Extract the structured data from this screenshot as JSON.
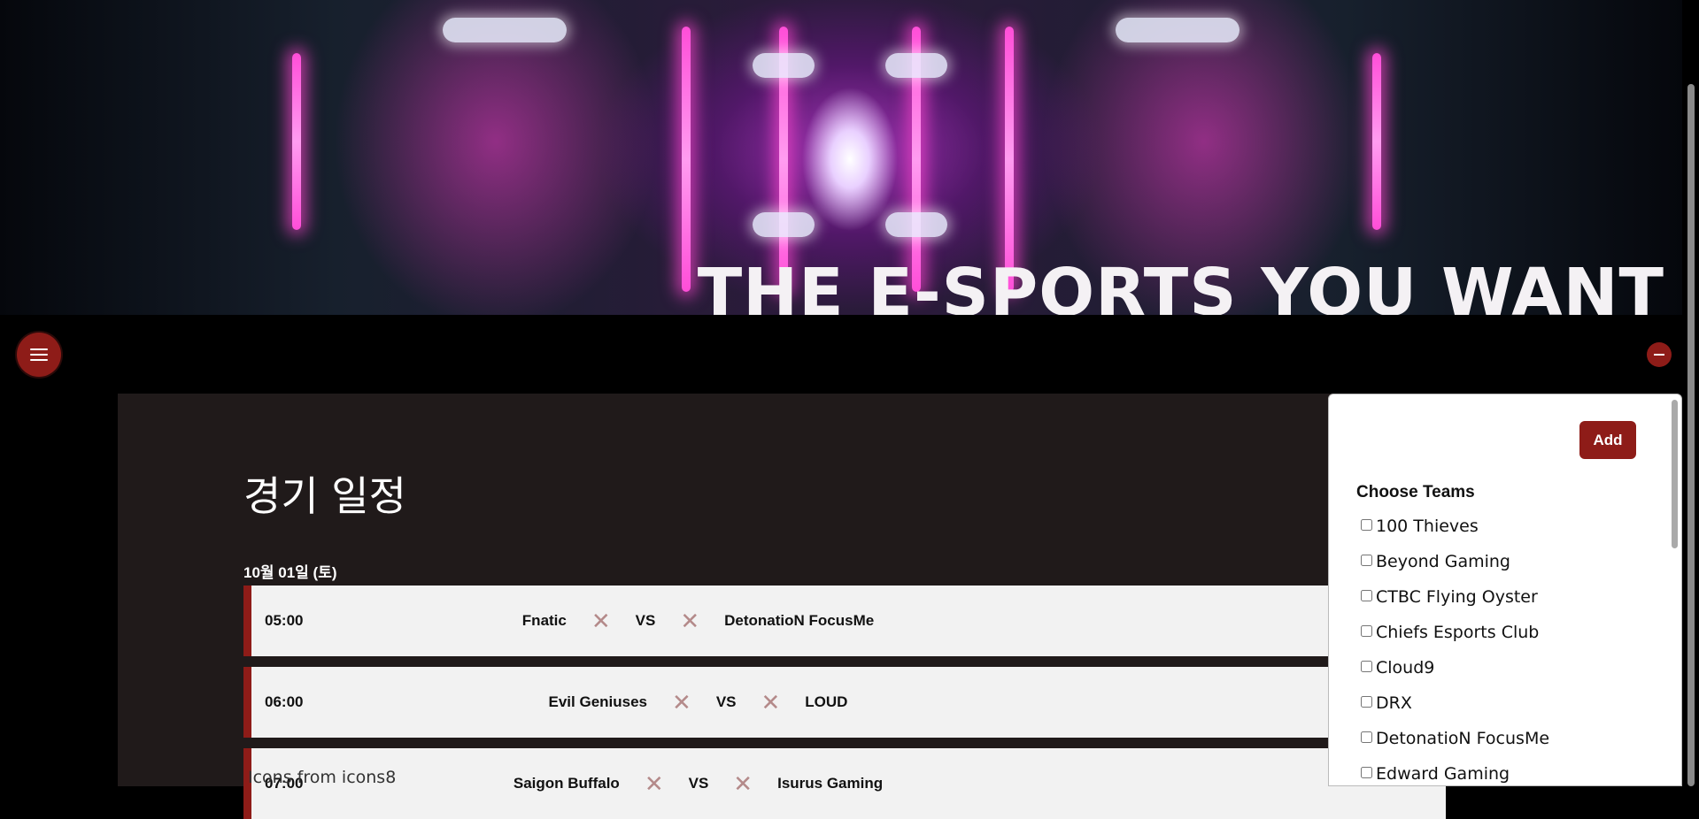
{
  "banner": {
    "title": "THE E-SPORTS YOU WANT"
  },
  "page": {
    "title": "경기 일정",
    "date": "10월 01일 (토)"
  },
  "matches": [
    {
      "time": "05:00",
      "home": "Fnatic",
      "vs": "VS",
      "away": "DetonatioN FocusMe"
    },
    {
      "time": "06:00",
      "home": "Evil Geniuses",
      "vs": "VS",
      "away": "LOUD"
    },
    {
      "time": "07:00",
      "home": "Saigon Buffalo",
      "vs": "VS",
      "away": "Isurus Gaming"
    }
  ],
  "footer": {
    "credit": "Icons from icons8"
  },
  "panel": {
    "add_label": "Add",
    "choose_label": "Choose Teams",
    "teams": [
      "100 Thieves",
      "Beyond Gaming",
      "CTBC Flying Oyster",
      "Chiefs Esports Club",
      "Cloud9",
      "DRX",
      "DetonatioN FocusMe",
      "Edward Gaming"
    ]
  },
  "icons": {
    "menu": "hamburger-menu-icon",
    "collapse": "minus-icon",
    "remove": "close-icon"
  },
  "colors": {
    "accent": "#8e1c18",
    "panel_bg": "#201a1a",
    "card_bg": "#f2f2f2"
  }
}
